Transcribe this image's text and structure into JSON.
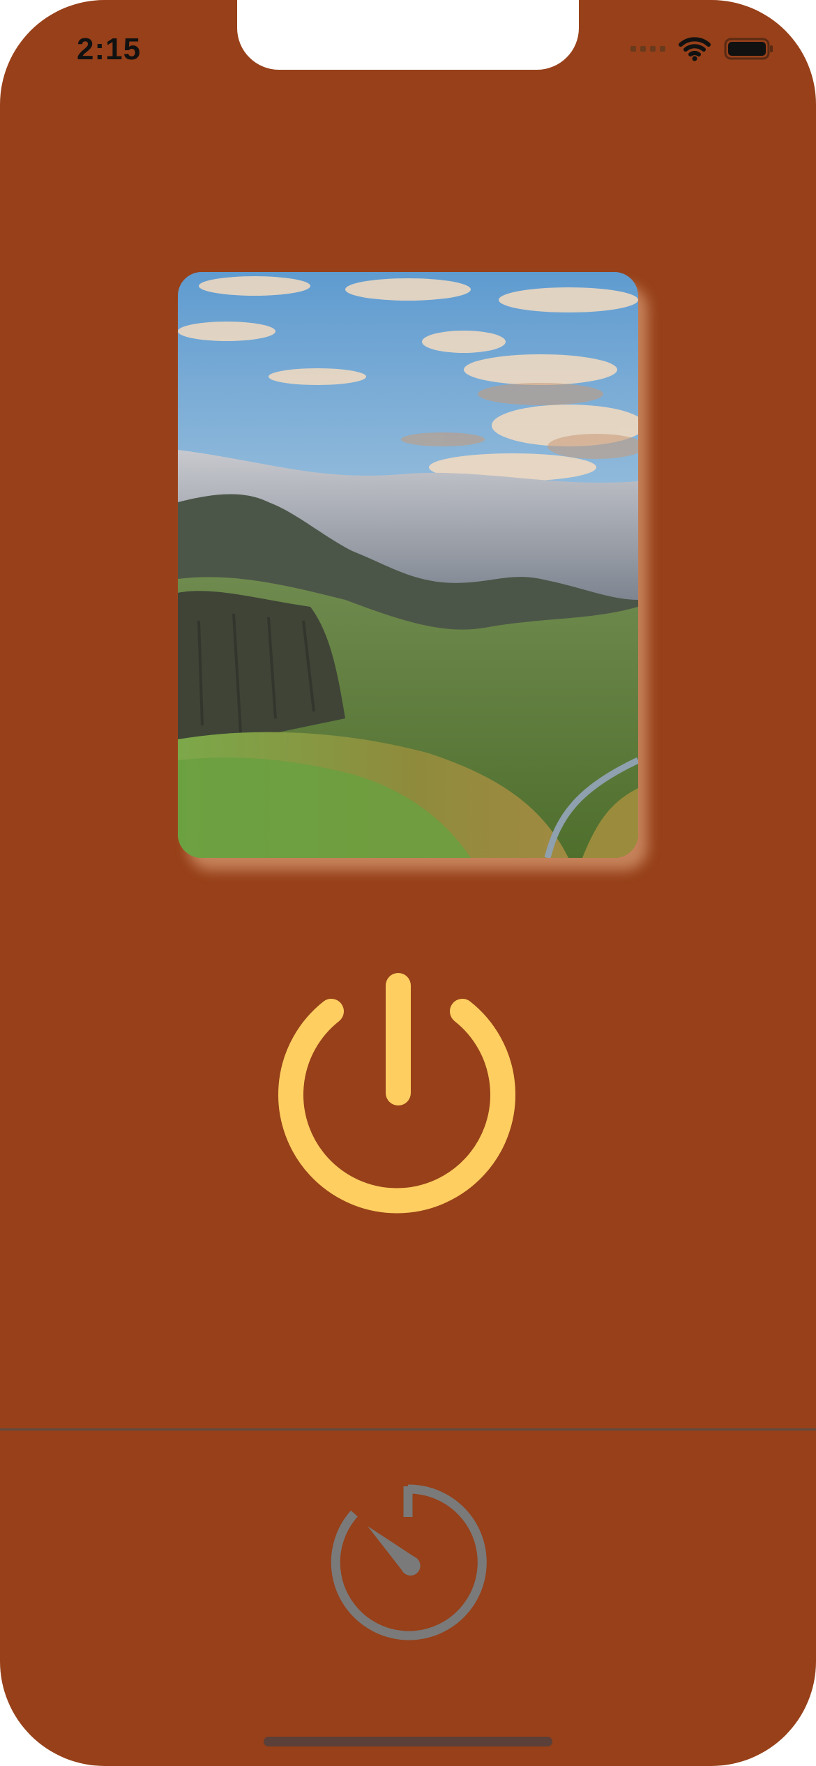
{
  "status_bar": {
    "time": "2:15",
    "icons": [
      "cellular-signal-icon",
      "wifi-icon",
      "battery-icon"
    ]
  },
  "main": {
    "image": {
      "kind": "landscape-photo"
    },
    "power_button": {
      "icon": "power-icon",
      "color": "#FFCE61"
    }
  },
  "bottom_bar": {
    "timer_button": {
      "icon": "timer-icon",
      "color": "#7A7A7A"
    }
  },
  "colors": {
    "background": "#974019",
    "divider": "#5F4B42",
    "accent": "#FFCE61",
    "inactive_icon": "#7A7A7A"
  }
}
